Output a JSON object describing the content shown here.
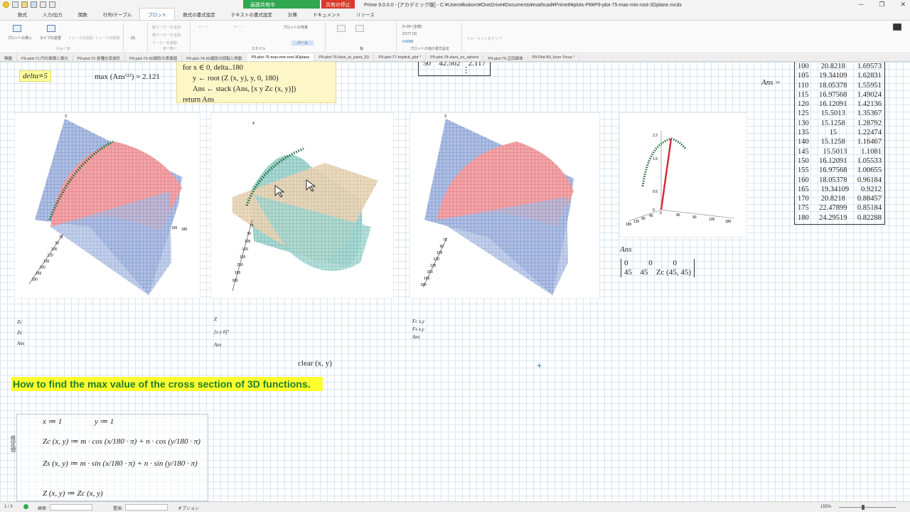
{
  "titlebar": {
    "sharing_label": "画面共有中",
    "stop_label": "共有の停止",
    "title": "Prime 9.0.0.0 - [アカデミック版] - C:¥Users¥kokoro¥OneDrive¥Documents¥mathcad¥Prime8¥plots-P8¥P9-plot-75-max-min-root-3Dplane.mcdx"
  },
  "menu_tabs": [
    "数式",
    "入力/出力",
    "関数",
    "行列/テーブル",
    "プロット",
    "数式の書式設定",
    "テキストの書式設定",
    "計算",
    "ドキュメント",
    "リソース"
  ],
  "active_menu_tab": "プロット",
  "ribbon": {
    "insert_plot": "プロットの挿入",
    "change_type": "タイプの変更",
    "trace_x": "トレースの追加",
    "trace_y": "トレースの削除",
    "trace_group": "トレース",
    "axis_value": "(0)",
    "marker_group": "マーカー",
    "marker_add_v": "縦マーカーを追加",
    "marker_add_h": "横マーカーを追加",
    "marker_del": "マーカーを削除",
    "style_group": "スタイル",
    "plot_bg": "プロットの背景",
    "perspective": "パース",
    "axes_group": "軸",
    "value_group": "プロットの値の書式設定",
    "numformat": "5×10² (全数)",
    "decimals": "0.577 (3)",
    "value_field": "0.5000",
    "format_clear": "フォーマットをクリア"
  },
  "doc_tabs": [
    "無題",
    "P9-plot-71-円の面積と積分",
    "P9-plot-72-各種交流波形",
    "P9-plot-73-3D図形の表面値",
    "P9-plot-74-3D図形の回転と移動",
    "P9-plot-75-max-min-root-3Dplane",
    "P9-plot-76-How_to_paint_2D",
    "P9-plot-77-Implicit_plot *",
    "P9-plot-78-stars_on_sphere",
    "P9-plot-79-正四面体",
    "P9-Plot-80_Horn Torus *"
  ],
  "active_doc_tab": "P9-plot-75-max-min-root-3Dplane",
  "worksheet": {
    "delta_def": "delta≡5",
    "max_expr": "max (Ans⁽²⁾) = 2.121",
    "program_lines": [
      "for x ∈ 0, delta..180",
      "y ← root (Z (x, y), y, 0, 180)",
      "Ans ← stack (Ans, [x  y  Zc (x, y)])",
      "return Ans"
    ],
    "matrix_top": {
      "c1": "50",
      "c2": "42.502",
      "c3": "2.117",
      "dots": "⋮"
    },
    "ans_label": "Ans =",
    "ans_rows": [
      [
        "100",
        "20.8218",
        "1.69573"
      ],
      [
        "105",
        "19.34109",
        "1.62831"
      ],
      [
        "110",
        "18.05378",
        "1.55951"
      ],
      [
        "115",
        "16.97568",
        "1.49024"
      ],
      [
        "120",
        "16.12091",
        "1.42136"
      ],
      [
        "125",
        "15.5013",
        "1.35367"
      ],
      [
        "130",
        "15.1258",
        "1.28792"
      ],
      [
        "135",
        "15",
        "1.22474"
      ],
      [
        "140",
        "15.1258",
        "1.16467"
      ],
      [
        "145",
        "15.5013",
        "1.1081"
      ],
      [
        "150",
        "16.12091",
        "1.05533"
      ],
      [
        "155",
        "16.97568",
        "1.00655"
      ],
      [
        "160",
        "18.05378",
        "0.96184"
      ],
      [
        "165",
        "19.34109",
        "0.9212"
      ],
      [
        "170",
        "20.8218",
        "0.88457"
      ],
      [
        "175",
        "22.47899",
        "0.85184"
      ],
      [
        "180",
        "24.29519",
        "0.82288"
      ]
    ],
    "plot1_legend": [
      "Zc",
      "Zs",
      "Ans"
    ],
    "plot2_legend": [
      "Z",
      "[x  y  0]ᵀ",
      "Ans"
    ],
    "plot3_legend": [
      "Fc x,y",
      "Fs x,y",
      "Ans"
    ],
    "small_plot_axis": {
      "y_ticks": [
        "2.2",
        "1.5",
        "0.5",
        "0"
      ],
      "x_ticks": [
        "0",
        "45",
        "90",
        "135",
        "180"
      ],
      "z_ticks": [
        "180",
        "135",
        "90",
        "45"
      ]
    },
    "plot1_ticks": {
      "y_top": "3",
      "x": [
        "165",
        "180"
      ],
      "z": [
        "75",
        "90",
        "105",
        "120",
        "135",
        "150",
        "165",
        "180"
      ]
    },
    "plot2_ticks": {
      "y_top": "4",
      "z": [
        "75",
        "90",
        "105",
        "120",
        "135",
        "150",
        "165",
        "180"
      ]
    },
    "plot3_ticks": {
      "y_top": "3",
      "z": [
        "75",
        "90",
        "105",
        "120",
        "135",
        "150",
        "165",
        "180"
      ]
    },
    "ans_small_label": "Ans",
    "ans_matrix": [
      [
        "0",
        "0",
        "0"
      ],
      [
        "45",
        "45",
        "Zc (45, 45)"
      ]
    ],
    "clear_expr": "clear (x, y)",
    "heading": "How to find the max value of the cross section of 3D functions.",
    "side_label": "推定値",
    "defs": {
      "x_def": "x ≔ 1",
      "y_def": "y ≔ 1",
      "zc_def": "Zc (x, y) ≔ m · cos (x/180 · π) + n · cos (y/180 · π)",
      "zs_def": "Zs (x, y) ≔ m · sin (x/180 · π) + n · sin (y/180 · π)",
      "z_partial": "Z (x, y) ≔ Zc (x, y)"
    }
  },
  "statusbar": {
    "page": "1 / 3",
    "search_label": "検索:",
    "replace_label": "置換:",
    "options_label": "オプション",
    "zoom": "155%"
  }
}
